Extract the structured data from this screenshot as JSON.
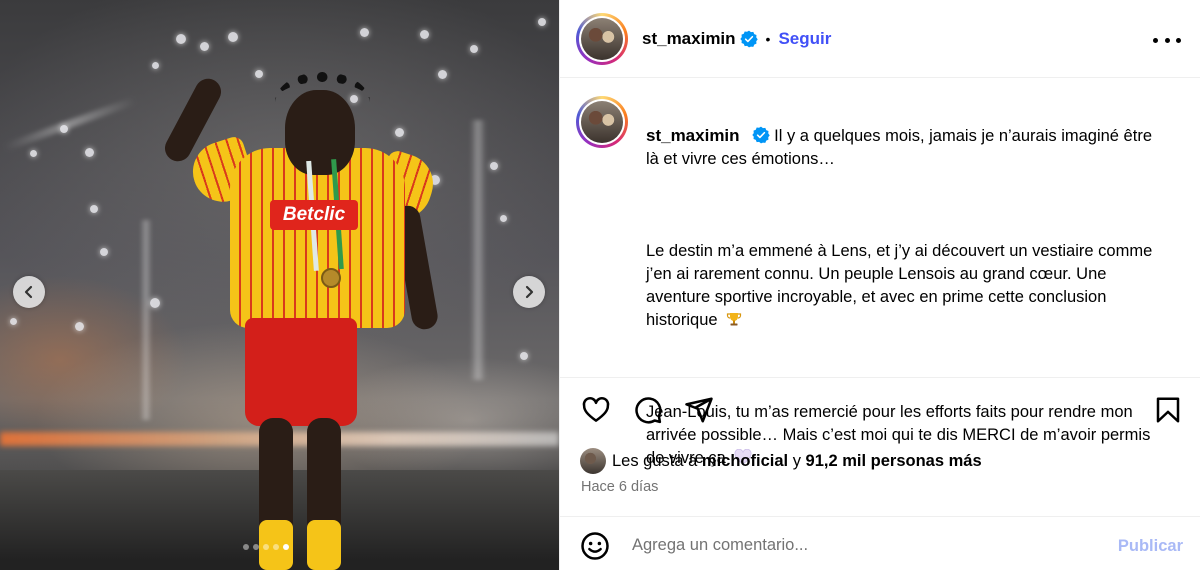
{
  "post": {
    "username": "st_maximin",
    "follow_label": "Seguir",
    "dot_separator": "•",
    "caption_lines": [
      "Il y a quelques mois, jamais je n'aurais imaginé être là et vivre ces émotions...",
      "",
      "Le destin m'a emmené à Lens, et j'y ai découvert un vestiaire comme j'en ai rarement connu. Un peuple Lensois au grand cœur. Une aventure sportive incroyable, et avec en prime cette conclusion historique",
      "",
      "Jean-Louis, tu m'as remercié pour les efforts faits pour rendre mon arrivée possible... Mais c'est moi qui te dis MERCI de m'avoir permis de vivre ça"
    ],
    "caption_para1": "Il y a quelques mois, jamais je n’aurais imaginé être là et vivre ces émotions…",
    "caption_para2": "Le destin m’a emmené à Lens, et j’y ai découvert un vestiaire comme j’en ai rarement connu. Un peuple Lensois au grand cœur. Une aventure sportive incroyable, et avec en prime cette conclusion historique",
    "caption_para3": "Jean-Louis, tu m’as remercié pour les efforts faits pour rendre mon arrivée possible… Mais c’est moi qui te dis MERCI de m’avoir permis de vivre ça",
    "likes_prefix": "Les gusta a",
    "likes_user": "michoficial",
    "likes_middle": "y",
    "likes_count": "91,2 mil personas más",
    "time_ago": "Hace 6 días",
    "comment_placeholder": "Agrega un comentario...",
    "publish_label": "Publicar"
  },
  "media": {
    "sponsor_text": "Betclic",
    "carousel_count": 5,
    "carousel_active_index": 4
  },
  "icons": {
    "verified": "verified-badge-icon",
    "more": "more-options-icon",
    "like": "heart-icon",
    "comment": "comment-icon",
    "share": "send-icon",
    "save": "bookmark-icon",
    "emoji": "smiley-icon",
    "prev": "chevron-left-icon",
    "next": "chevron-right-icon",
    "trophy": "trophy-emoji-icon",
    "heart_emoji": "light-purple-heart-emoji-icon"
  },
  "colors": {
    "accent_blue": "#4150f7",
    "verified_blue": "#0095f6",
    "publish_disabled": "#a9b9f6",
    "muted_text": "#737373",
    "divider": "#efefef"
  }
}
